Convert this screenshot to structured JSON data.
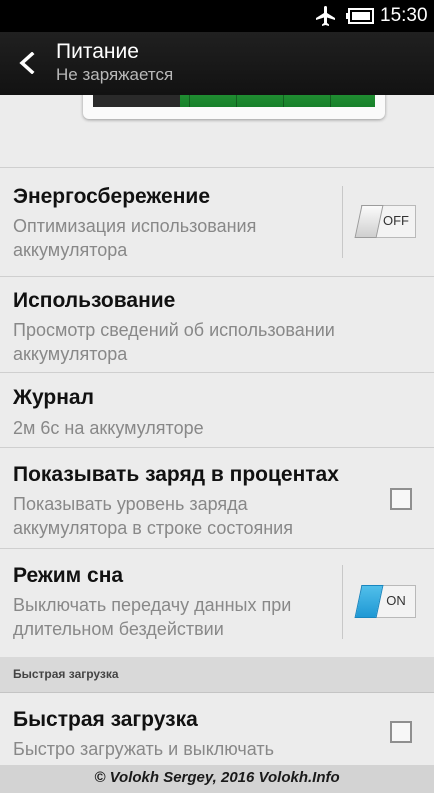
{
  "status_bar": {
    "time": "15:30",
    "icons": [
      "airplane-mode-icon",
      "battery-icon"
    ]
  },
  "action_bar": {
    "title": "Питание",
    "subtitle": "Не заряжается",
    "back_icon": "chevron-left-icon"
  },
  "battery_graphic": {
    "charge_fraction": 0.69
  },
  "settings": [
    {
      "title": "Энергосбережение",
      "summary": "Оптимизация использования аккумулятора",
      "control": "toggle",
      "state": "OFF"
    },
    {
      "title": "Использование",
      "summary": "Просмотр сведений об использовании аккумулятора"
    },
    {
      "title": "Журнал",
      "summary": "2м 6с на аккумуляторе"
    },
    {
      "title": "Показывать заряд в процентах",
      "summary": "Показывать уровень заряда аккумулятора в строке состояния",
      "control": "checkbox",
      "checked": false
    },
    {
      "title": "Режим сна",
      "summary": "Выключать передачу данных при длительном бездействии",
      "control": "toggle",
      "state": "ON"
    }
  ],
  "section": {
    "title": "Быстрая загрузка"
  },
  "fast_boot": {
    "title": "Быстрая загрузка",
    "summary": "Быстро загружать и выключать",
    "control": "checkbox",
    "checked": false
  },
  "watermark": "© Volokh Sergey, 2016 Volokh.Info",
  "colors": {
    "action_bar": "#1a1a1a",
    "accent_blue": "#2aa6df",
    "battery_green": "#1f8f33",
    "background": "#ececec"
  }
}
